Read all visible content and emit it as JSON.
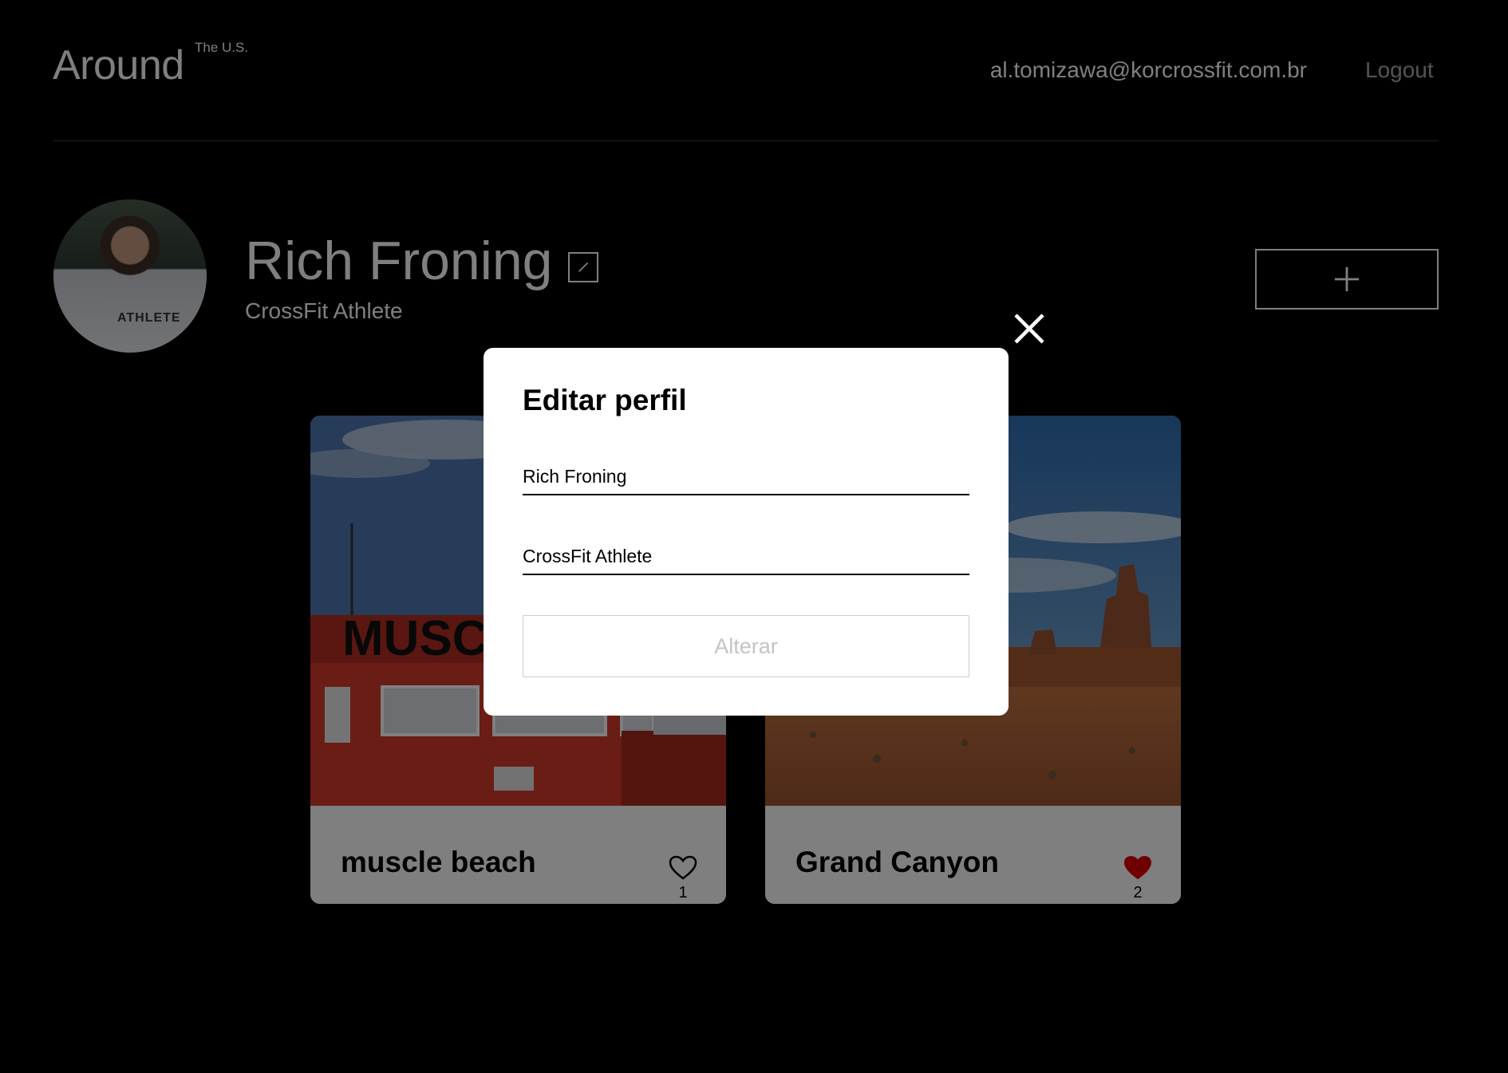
{
  "header": {
    "logo": "Around",
    "logo_sup": "The U.S.",
    "email": "al.tomizawa@korcrossfit.com.br",
    "logout": "Logout"
  },
  "profile": {
    "name": "Rich Froning",
    "about": "CrossFit Athlete",
    "avatar_shirt_text": "ATHLETE"
  },
  "cards": [
    {
      "title": "muscle beach",
      "likes": "1",
      "liked": false,
      "sign_text": "MUSCL"
    },
    {
      "title": "Grand Canyon",
      "likes": "2",
      "liked": true
    }
  ],
  "modal": {
    "title": "Editar perfil",
    "name_value": "Rich Froning",
    "about_value": "CrossFit Athlete",
    "submit_label": "Alterar"
  },
  "icons": {
    "edit": "pencil-icon",
    "add": "plus-icon",
    "close": "close-icon",
    "like": "heart-icon"
  },
  "colors": {
    "background": "#000000",
    "like_active": "#e00000",
    "submit_disabled_text": "#c4c4c4"
  }
}
